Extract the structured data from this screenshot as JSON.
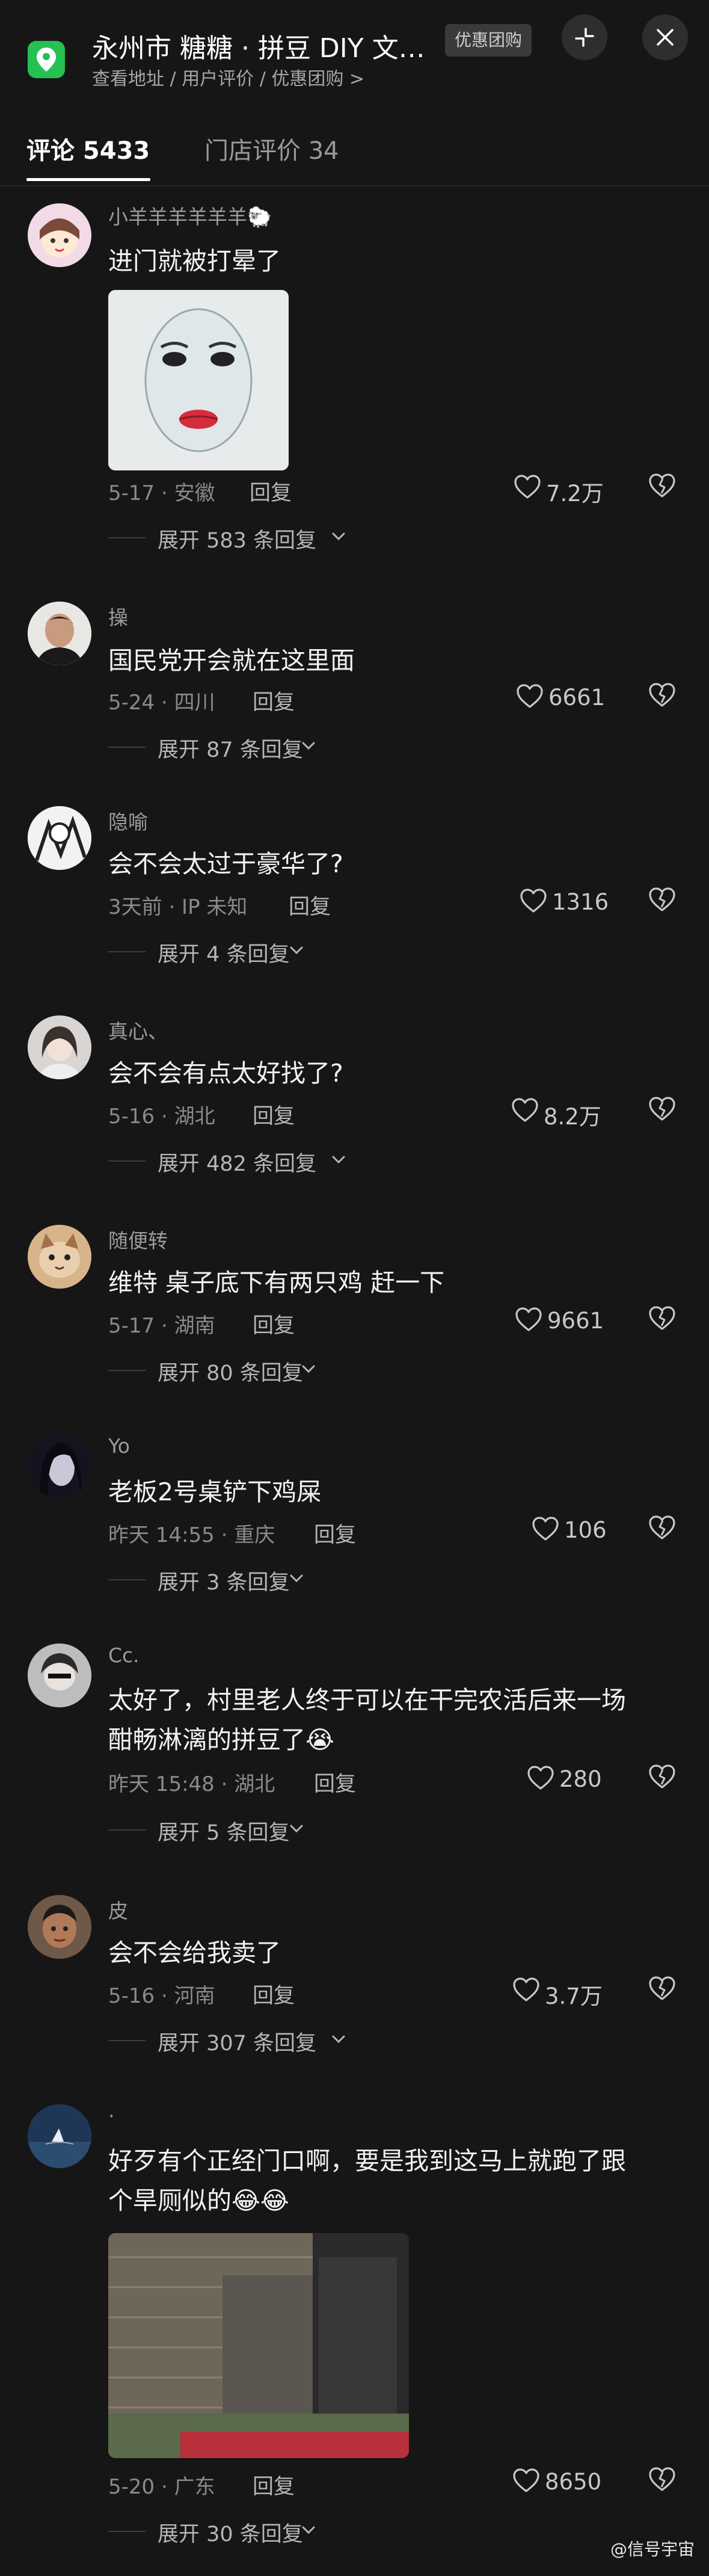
{
  "header": {
    "title": "永州市  糖糖 · 拼豆 DIY 文…",
    "promo_badge": "优惠团购",
    "subline": "查看地址 / 用户评价 / 优惠团购 >"
  },
  "tabs": [
    {
      "label": "评论 5433"
    },
    {
      "label": "门店评价 34"
    }
  ],
  "comments": [
    {
      "user": "小羊羊羊羊羊羊🐑",
      "lines": [
        "进门就被打晕了"
      ],
      "meta": "5-17 · 安徽",
      "reply": "回复",
      "likes": "7.2万",
      "expand": "展开 583 条回复"
    },
    {
      "user": "操",
      "lines": [
        "国民党开会就在这里面"
      ],
      "meta": "5-24 · 四川",
      "reply": "回复",
      "likes": "6661",
      "expand": "展开 87 条回复"
    },
    {
      "user": "隐喻",
      "lines": [
        "会不会太过于豪华了?"
      ],
      "meta": "3天前 · IP 未知",
      "reply": "回复",
      "likes": "1316",
      "expand": "展开 4 条回复"
    },
    {
      "user": "真心、",
      "lines": [
        "会不会有点太好找了?"
      ],
      "meta": "5-16 · 湖北",
      "reply": "回复",
      "likes": "8.2万",
      "expand": "展开 482 条回复"
    },
    {
      "user": "随便转",
      "lines": [
        "维特 桌子底下有两只鸡 赶一下"
      ],
      "meta": "5-17 · 湖南",
      "reply": "回复",
      "likes": "9661",
      "expand": "展开 80 条回复"
    },
    {
      "user": "Yo",
      "lines": [
        "老板2号桌铲下鸡屎"
      ],
      "meta": "昨天 14:55 · 重庆",
      "reply": "回复",
      "likes": "106",
      "expand": "展开 3 条回复"
    },
    {
      "user": "Cc.",
      "lines": [
        "太好了，村里老人终于可以在干完农活后来一场",
        "酣畅淋漓的拼豆了😭"
      ],
      "meta": "昨天 15:48 · 湖北",
      "reply": "回复",
      "likes": "280",
      "expand": "展开 5 条回复"
    },
    {
      "user": "皮",
      "lines": [
        "会不会给我卖了"
      ],
      "meta": "5-16 · 河南",
      "reply": "回复",
      "likes": "3.7万",
      "expand": "展开 307 条回复"
    },
    {
      "user": "·",
      "lines": [
        "好歹有个正经门口啊，要是我到这马上就跑了跟",
        "个旱厕似的😂😂"
      ],
      "meta": "5-20 · 广东",
      "reply": "回复",
      "likes": "8650",
      "expand": "展开 30 条回复"
    }
  ],
  "watermark": "@信号宇宙",
  "colors": {
    "background": "#161616",
    "accent_green": "#27c052"
  }
}
